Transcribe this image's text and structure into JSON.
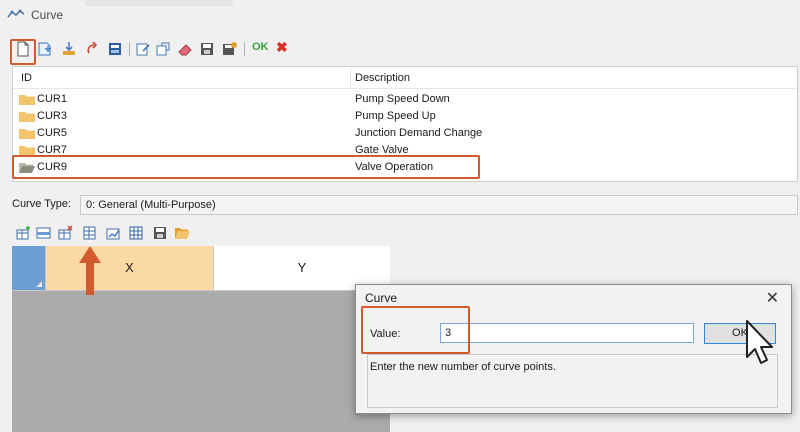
{
  "window": {
    "title": "Curve",
    "app_icon": "curve-app-icon"
  },
  "toolbar": {
    "icons": [
      "new-icon",
      "add-icon",
      "import-icon",
      "refresh-icon",
      "database-icon",
      "edit-icon",
      "copy-icon",
      "eraser-icon",
      "save-icon",
      "save-as-icon"
    ],
    "ok_label": "OK",
    "cancel_glyph": "✖"
  },
  "list": {
    "headers": {
      "id": "ID",
      "description": "Description"
    },
    "rows": [
      {
        "id": "CUR1",
        "description": "Pump Speed Down"
      },
      {
        "id": "CUR3",
        "description": "Pump Speed Up"
      },
      {
        "id": "CUR5",
        "description": "Junction Demand Change"
      },
      {
        "id": "CUR7",
        "description": "Gate Valve"
      },
      {
        "id": "CUR9",
        "description": "Valve Operation"
      }
    ],
    "highlighted_row": "CUR9"
  },
  "curve_type": {
    "label": "Curve Type:",
    "value": "0: General (Multi-Purpose)"
  },
  "grid": {
    "columns": [
      "X",
      "Y"
    ],
    "toolbar_icons": [
      "add-row-icon",
      "insert-row-icon",
      "delete-row-icon",
      "set-points-icon",
      "chart-icon",
      "table-icon",
      "save-icon",
      "open-folder-icon"
    ]
  },
  "dialog": {
    "title": "Curve",
    "close_glyph": "✕",
    "value_label": "Value:",
    "value": "3",
    "ok_label": "OK",
    "description": "Enter the new number of curve points."
  },
  "colors": {
    "highlight": "#d35a2e",
    "selected_column": "#fbd9a4",
    "grid_corner": "#6c9ed3",
    "ok_green": "#3aa03a",
    "cancel_red": "#d93025"
  }
}
